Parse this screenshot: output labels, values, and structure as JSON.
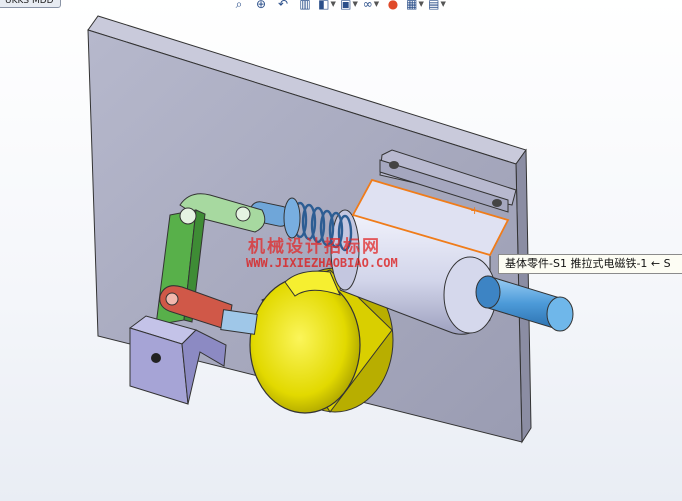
{
  "document_tab": {
    "label": "UKKS MDD"
  },
  "toolbar": {
    "items": [
      {
        "name": "zoom-to-fit",
        "glyph": "⌕"
      },
      {
        "name": "zoom-to-area",
        "glyph": "⊕"
      },
      {
        "name": "previous-view",
        "glyph": "↶"
      },
      {
        "name": "section-view",
        "glyph": "▥"
      },
      {
        "name": "view-orientation",
        "glyph": "◧"
      },
      {
        "name": "display-style",
        "glyph": "▣"
      },
      {
        "name": "hide-show-items",
        "glyph": "∞"
      },
      {
        "name": "edit-appearance",
        "glyph": "●"
      },
      {
        "name": "apply-scene",
        "glyph": "▦"
      },
      {
        "name": "view-settings",
        "glyph": "▤"
      }
    ]
  },
  "watermark": {
    "text": "机械设计招标网",
    "url": "WWW.JIXIEZHAOBIAO.COM"
  },
  "tooltip": {
    "text": "基体零件-S1 推拉式电磁铁-1 ← S"
  },
  "colors": {
    "plate": "#a9abc2",
    "bracket": "#aaa8d6",
    "green_link": "#59b04a",
    "red_link": "#d05848",
    "solenoid_body": "#d8dbee",
    "plunger": "#5aa6dd",
    "yellow_part": "#e8e000",
    "selection": "#f07c1a"
  }
}
